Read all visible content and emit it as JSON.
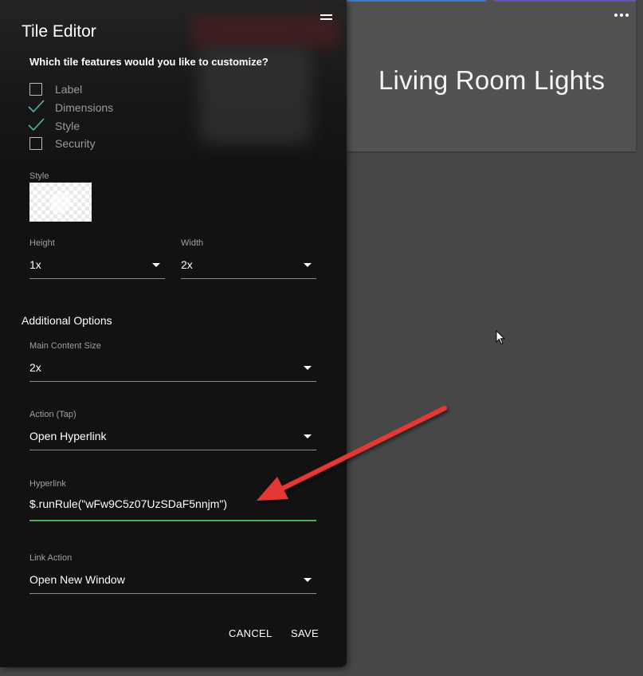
{
  "tile": {
    "title": "Living Room Lights",
    "menu_icon": "more-horizontal-icon"
  },
  "editor": {
    "title": "Tile Editor",
    "handle_icon": "drag-handle-icon",
    "question": "Which tile features would you like to customize?",
    "features": [
      {
        "label": "Label",
        "checked": false
      },
      {
        "label": "Dimensions",
        "checked": true
      },
      {
        "label": "Style",
        "checked": true
      },
      {
        "label": "Security",
        "checked": false
      }
    ],
    "style_label": "Style",
    "height": {
      "label": "Height",
      "value": "1x"
    },
    "width": {
      "label": "Width",
      "value": "2x"
    },
    "additional_options": "Additional Options",
    "main_content_size": {
      "label": "Main Content Size",
      "value": "2x"
    },
    "action": {
      "label": "Action (Tap)",
      "value": "Open Hyperlink"
    },
    "hyperlink": {
      "label": "Hyperlink",
      "value": "$.runRule(\"wFw9C5z07UzSDaF5nnjm\")"
    },
    "link_action": {
      "label": "Link Action",
      "value": "Open New Window"
    },
    "cancel_label": "CANCEL",
    "save_label": "SAVE"
  },
  "colors": {
    "background": "#474747",
    "panel": "#121212",
    "accent_check": "#4db6ac",
    "input_focus": "#4caf50",
    "annotation_arrow": "#e53935"
  }
}
